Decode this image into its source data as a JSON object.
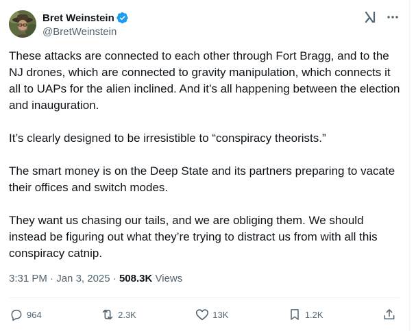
{
  "author": {
    "display_name": "Bret Weinstein",
    "handle": "@BretWeinstein",
    "verified": true
  },
  "post": {
    "paragraphs": [
      "These attacks are connected to each other through Fort Bragg, and to the NJ drones, which are connected to gravity manipulation, which connects it all to UAPs for the alien inclined. And it’s all happening between the election and inauguration.",
      "It’s clearly designed to be irresistible to “conspiracy theorists.”",
      "The smart money is on the Deep State and its partners preparing to vacate their offices and switch modes.",
      "They want us chasing our tails, and we are obliging them. We should instead be figuring out what they’re trying to distract us from with all this conspiracy catnip."
    ]
  },
  "meta": {
    "time": "3:31 PM",
    "separator": " · ",
    "date": "Jan 3, 2025",
    "views_count": "508.3K",
    "views_label": " Views"
  },
  "actions": {
    "replies": "964",
    "reposts": "2.3K",
    "likes": "13K",
    "bookmarks": "1.2K"
  },
  "icons": {
    "verified": "verified-badge-icon",
    "grok": "grok-icon",
    "more": "more-icon",
    "reply": "reply-icon",
    "repost": "repost-icon",
    "like": "heart-icon",
    "bookmark": "bookmark-icon",
    "share": "share-icon"
  },
  "colors": {
    "text_primary": "#0f1419",
    "text_secondary": "#536471",
    "verified_blue": "#1d9bf0",
    "divider": "#eff3f4"
  }
}
